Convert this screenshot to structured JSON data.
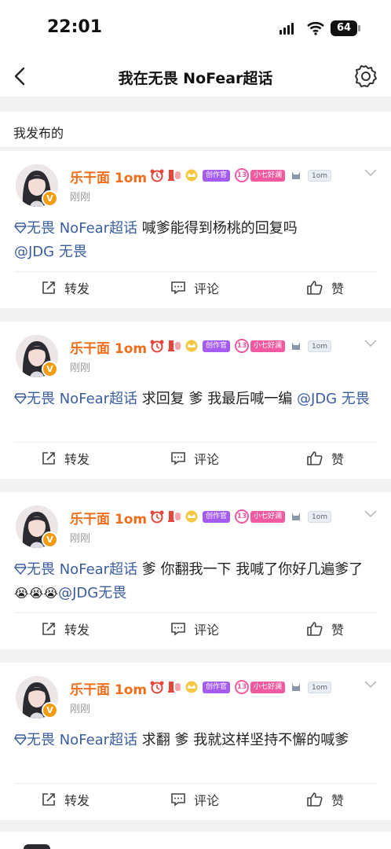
{
  "status_bar": {
    "time": "22:01",
    "battery": "64"
  },
  "nav": {
    "title": "我在无畏 NoFear超话"
  },
  "section": {
    "title": "我发布的"
  },
  "posts": [
    {
      "username": "乐干面 1om",
      "time": "刚刚",
      "badge_creator": "创作官",
      "badge_level": "13",
      "badge_fan": "小七好澜",
      "badge_tag": "1om",
      "topic": "无畏 NoFear超话",
      "text": " 喊爹能得到杨桃的回复吗",
      "mention": "@JDG 无畏",
      "repost": "转发",
      "comment": "评论",
      "like": "赞"
    },
    {
      "username": "乐干面 1om",
      "time": "刚刚",
      "badge_creator": "创作官",
      "badge_level": "13",
      "badge_fan": "小七好澜",
      "badge_tag": "1om",
      "topic": "无畏 NoFear超话",
      "text": " 求回复 爹 我最后喊一编 ",
      "mention": "@JDG 无畏",
      "repost": "转发",
      "comment": "评论",
      "like": "赞"
    },
    {
      "username": "乐干面 1om",
      "time": "刚刚",
      "badge_creator": "创作官",
      "badge_level": "13",
      "badge_fan": "小七好澜",
      "badge_tag": "1om",
      "topic": "无畏 NoFear超话",
      "text": " 爹 你翻我一下 我喊了你好几遍爹了",
      "emoji": "😭😭😭",
      "mention": "@JDG无畏",
      "repost": "转发",
      "comment": "评论",
      "like": "赞"
    },
    {
      "username": "乐干面 1om",
      "time": "刚刚",
      "badge_creator": "创作官",
      "badge_level": "13",
      "badge_fan": "小七好澜",
      "badge_tag": "1om",
      "topic": "无畏 NoFear超话",
      "text": " 求翻 爹 我就这样坚持不懈的喊爹",
      "repost": "转发",
      "comment": "评论",
      "like": "赞"
    }
  ],
  "icons": {
    "back": "chevron-left-icon",
    "settings": "gear-icon",
    "topic": "diamond-icon",
    "verified": "v-badge-icon",
    "repost": "share-icon",
    "comment": "comment-icon",
    "like": "thumbs-up-icon",
    "menu": "chevron-down-icon"
  },
  "colors": {
    "username": "#f06e1c",
    "topic_link": "#3a5d9e",
    "creator_badge": "#a55bf0",
    "fan_badge": "#f05aa0"
  }
}
